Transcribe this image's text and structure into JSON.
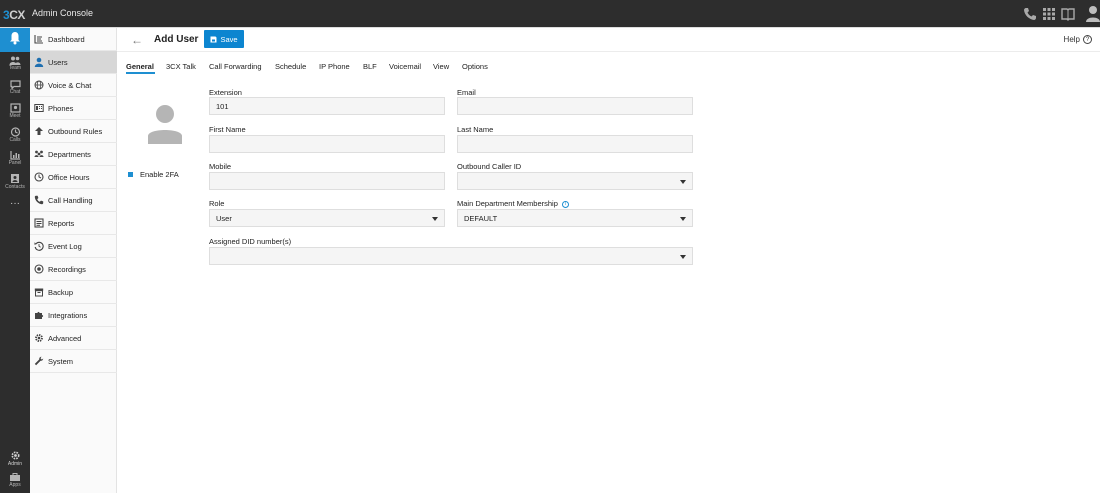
{
  "app": {
    "logo_3": "3",
    "logo_cx": "CX",
    "title": "Admin Console"
  },
  "rail": [
    {
      "label": "",
      "icon": "bell-icon"
    },
    {
      "label": "Team",
      "icon": "team-icon"
    },
    {
      "label": "Chat",
      "icon": "chat-icon"
    },
    {
      "label": "Meet",
      "icon": "meet-icon"
    },
    {
      "label": "Calls",
      "icon": "calls-icon"
    },
    {
      "label": "Panel",
      "icon": "panel-icon"
    },
    {
      "label": "Contacts",
      "icon": "contacts-icon"
    },
    {
      "label": "···",
      "icon": "more-icon"
    },
    {
      "label": "Admin",
      "icon": "gear-icon"
    },
    {
      "label": "Apps",
      "icon": "apps-icon"
    }
  ],
  "nav": [
    {
      "label": "Dashboard",
      "icon": "dashboard-icon"
    },
    {
      "label": "Users",
      "icon": "user-icon",
      "active": true
    },
    {
      "label": "Voice & Chat",
      "icon": "globe-icon"
    },
    {
      "label": "Phones",
      "icon": "phone-device-icon"
    },
    {
      "label": "Outbound Rules",
      "icon": "arrow-up-icon"
    },
    {
      "label": "Departments",
      "icon": "departments-icon"
    },
    {
      "label": "Office Hours",
      "icon": "clock-icon"
    },
    {
      "label": "Call Handling",
      "icon": "phone-icon"
    },
    {
      "label": "Reports",
      "icon": "reports-icon"
    },
    {
      "label": "Event Log",
      "icon": "history-icon"
    },
    {
      "label": "Recordings",
      "icon": "record-icon"
    },
    {
      "label": "Backup",
      "icon": "backup-icon"
    },
    {
      "label": "Integrations",
      "icon": "puzzle-icon"
    },
    {
      "label": "Advanced",
      "icon": "cog-icon"
    },
    {
      "label": "System",
      "icon": "wrench-icon"
    }
  ],
  "header": {
    "back": "←",
    "title": "Add User",
    "save": "Save",
    "help": "Help",
    "help_glyph": "?"
  },
  "tabs": [
    "General",
    "3CX Talk",
    "Call Forwarding",
    "Schedule",
    "IP Phone",
    "BLF",
    "Voicemail",
    "View",
    "Options"
  ],
  "profile": {
    "enable_2fa": "Enable 2FA"
  },
  "form": {
    "extension_label": "Extension",
    "extension_value": "101",
    "email_label": "Email",
    "email_value": "",
    "first_name_label": "First Name",
    "first_name_value": "",
    "last_name_label": "Last Name",
    "last_name_value": "",
    "mobile_label": "Mobile",
    "mobile_value": "",
    "outbound_caller_id_label": "Outbound Caller ID",
    "outbound_caller_id_value": "",
    "role_label": "Role",
    "role_value": "User",
    "main_dept_label": "Main Department Membership",
    "main_dept_value": "DEFAULT",
    "did_label": "Assigned DID number(s)",
    "did_value": ""
  },
  "colors": {
    "accent": "#1e8fd1",
    "topbar": "#2d2d2d",
    "save": "#0c85d0"
  }
}
